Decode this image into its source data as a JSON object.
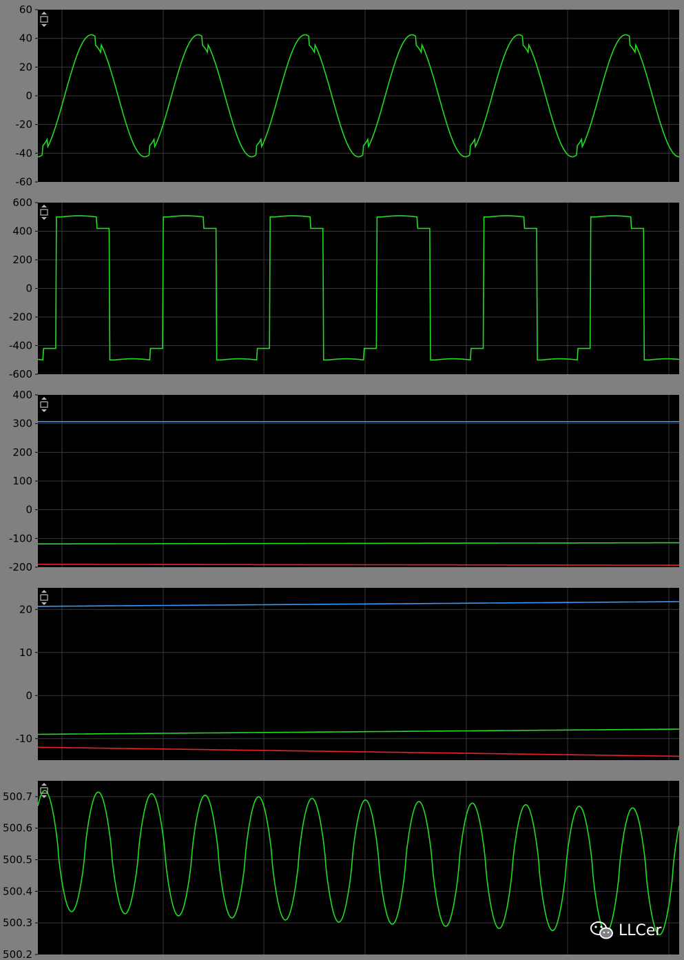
{
  "watermark": {
    "text": "LLCer",
    "icon": "wechat-icon"
  },
  "colors": {
    "background": "#808080",
    "plot_bg": "#000000",
    "grid": "#3a3a3a",
    "green": "#22dd22",
    "blue": "#3399ff",
    "red": "#ee2222"
  },
  "panel_control_icon": "resize-toggle-icon",
  "chart_data": [
    {
      "type": "line",
      "ylim": [
        -60,
        60
      ],
      "yticks": [
        "60",
        "40",
        "20",
        "0",
        "-20",
        "-40",
        "-60"
      ],
      "grid": true,
      "series": [
        {
          "color": "#22dd22",
          "kind": "sine-notched",
          "amplitude": 42.5,
          "periods": 6,
          "phase": 0.75,
          "notch": 6
        }
      ]
    },
    {
      "type": "line",
      "ylim": [
        -600,
        600
      ],
      "yticks": [
        "600",
        "400",
        "200",
        "0",
        "-200",
        "-400",
        "-600"
      ],
      "grid": true,
      "series": [
        {
          "color": "#22dd22",
          "kind": "square-stepped",
          "high": 500,
          "low": -500,
          "step_high": 420,
          "step_low": -420,
          "periods": 6
        }
      ]
    },
    {
      "type": "line",
      "ylim": [
        -200,
        400
      ],
      "yticks": [
        "400",
        "300",
        "200",
        "100",
        "0",
        "-100",
        "-200"
      ],
      "grid": true,
      "series": [
        {
          "color": "#3399ff",
          "kind": "flat",
          "values": [
            307,
            307
          ]
        },
        {
          "color": "#22dd22",
          "kind": "flat",
          "values": [
            -119,
            -115
          ]
        },
        {
          "color": "#ee2222",
          "kind": "flat",
          "values": [
            -190,
            -193
          ]
        }
      ]
    },
    {
      "type": "line",
      "ylim": [
        -15,
        25
      ],
      "yticks": [
        "20",
        "10",
        "0",
        "-10"
      ],
      "grid": true,
      "series": [
        {
          "color": "#3399ff",
          "kind": "flat",
          "values": [
            20.7,
            21.8
          ]
        },
        {
          "color": "#22dd22",
          "kind": "flat",
          "values": [
            -9.0,
            -7.8
          ]
        },
        {
          "color": "#ee2222",
          "kind": "flat",
          "values": [
            -12.0,
            -14.1
          ]
        }
      ]
    },
    {
      "type": "line",
      "ylim": [
        500.2,
        500.75
      ],
      "yticks": [
        "500.7",
        "500.6",
        "500.5",
        "500.4",
        "500.3",
        "500.2"
      ],
      "grid": true,
      "series": [
        {
          "color": "#22dd22",
          "kind": "ripple",
          "periods": 12,
          "max_start": 500.72,
          "max_end": 500.66,
          "min_start": 500.34,
          "min_end": 500.26
        }
      ]
    }
  ]
}
